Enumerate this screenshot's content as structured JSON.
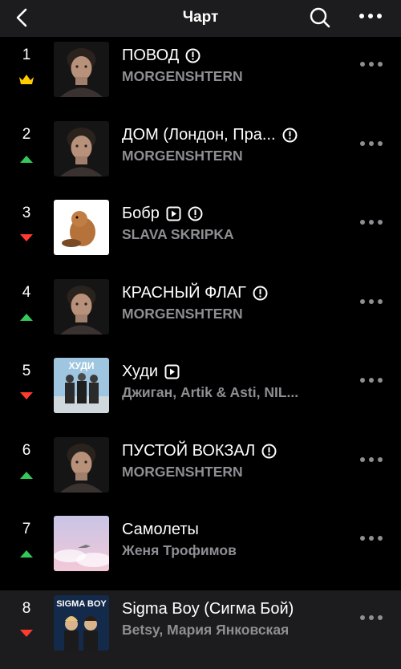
{
  "header": {
    "title": "Чарт",
    "back_icon": "chevron-left-icon",
    "search_icon": "search-icon",
    "more_icon": "more-horizontal-icon"
  },
  "colors": {
    "background": "#000000",
    "header_bg": "#1c1c1e",
    "secondary_text": "#8e8e93",
    "up": "#34c759",
    "down": "#ff3b30",
    "crown": "#ffcc00"
  },
  "tracks": [
    {
      "rank": "1",
      "indicator": "crown",
      "title": "ПОВОД",
      "artist": "MORGENSHTERN",
      "explicit": true,
      "video": false
    },
    {
      "rank": "2",
      "indicator": "up",
      "title": "ДОМ (Лондон, Пра...",
      "artist": "MORGENSHTERN",
      "explicit": true,
      "video": false
    },
    {
      "rank": "3",
      "indicator": "down",
      "title": "Бобр",
      "artist": "SLAVA SKRIPKA",
      "explicit": true,
      "video": true
    },
    {
      "rank": "4",
      "indicator": "up",
      "title": "КРАСНЫЙ ФЛАГ",
      "artist": "MORGENSHTERN",
      "explicit": true,
      "video": false
    },
    {
      "rank": "5",
      "indicator": "down",
      "title": "Худи",
      "artist": "Джиган, Artik & Asti, NIL...",
      "explicit": false,
      "video": true,
      "cover_text": "ХУДИ"
    },
    {
      "rank": "6",
      "indicator": "up",
      "title": "ПУСТОЙ ВОКЗАЛ",
      "artist": "MORGENSHTERN",
      "explicit": true,
      "video": false
    },
    {
      "rank": "7",
      "indicator": "up",
      "title": "Самолеты",
      "artist": "Женя Трофимов",
      "explicit": false,
      "video": false
    },
    {
      "rank": "8",
      "indicator": "down",
      "title": "Sigma Boy (Сигма Бой)",
      "artist": "Betsy, Мария Янковская",
      "explicit": false,
      "video": false,
      "cover_text": "SIGMA BOY",
      "highlighted": true
    }
  ]
}
